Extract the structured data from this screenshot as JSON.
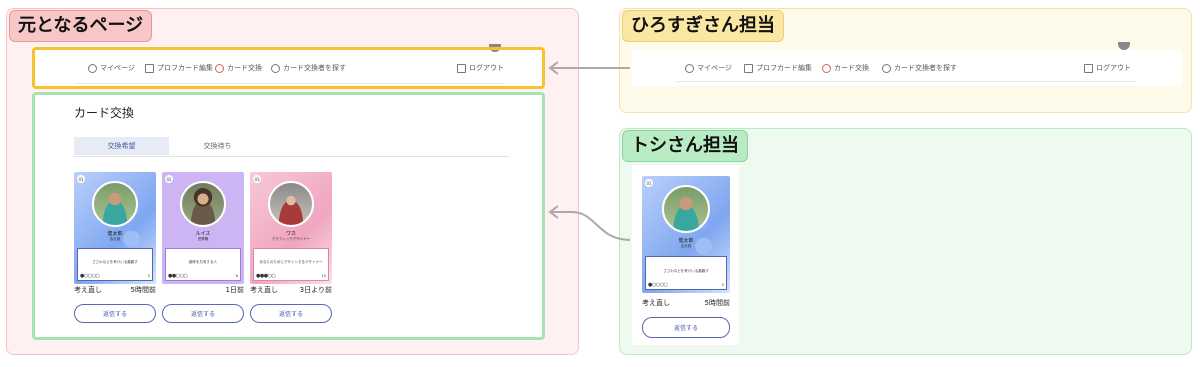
{
  "labels": {
    "original": "元となるページ",
    "hirosugi": "ひろすぎさん担当",
    "toshi": "トシさん担当"
  },
  "nav": {
    "mypage": "マイページ",
    "profile_edit": "プロフカード編集",
    "card_exchange": "カード交換",
    "find_partner": "カード交換者を探す",
    "logout": "ログアウト"
  },
  "exchange": {
    "title": "カード交換",
    "tab_wanted": "交換希望",
    "tab_waiting": "交換待ち"
  },
  "cards": [
    {
      "num": "01",
      "name": "健太郎",
      "sub": "会社員",
      "msg": "ささわなどを考けいる趣趣す",
      "dots": "●○○○○",
      "count": "5",
      "status": "考え直し",
      "time": "5時間前",
      "button": "返信する"
    },
    {
      "num": "02",
      "name": "ルイス",
      "sub": "営業職",
      "msg": "趣味を共有する人",
      "dots": "●●○○○",
      "count": "8",
      "status": "",
      "time": "1日前",
      "button": "返信する"
    },
    {
      "num": "03",
      "name": "ワカ",
      "sub": "グラフィックデザイナー",
      "msg": "あなたのためにデザインするデザイナー",
      "dots": "●●●○○",
      "count": "10",
      "status": "考え直し",
      "time": "3日より前",
      "button": "返信する"
    }
  ],
  "toshi_card": {
    "num": "01",
    "name": "健太郎",
    "sub": "会社員",
    "msg": "ささわなどを考けいる趣趣す",
    "dots": "●○○○○",
    "count": "5",
    "status": "考え直し",
    "time": "5時間前",
    "button": "返信する"
  },
  "colors": {
    "original_frame": "#fff1f1",
    "hiro_frame": "#fffbea",
    "toshi_frame": "#eefaf0",
    "nav_highlight": "#f5c230",
    "exchange_highlight": "#a6e3b3",
    "button_accent": "#5968b5"
  }
}
